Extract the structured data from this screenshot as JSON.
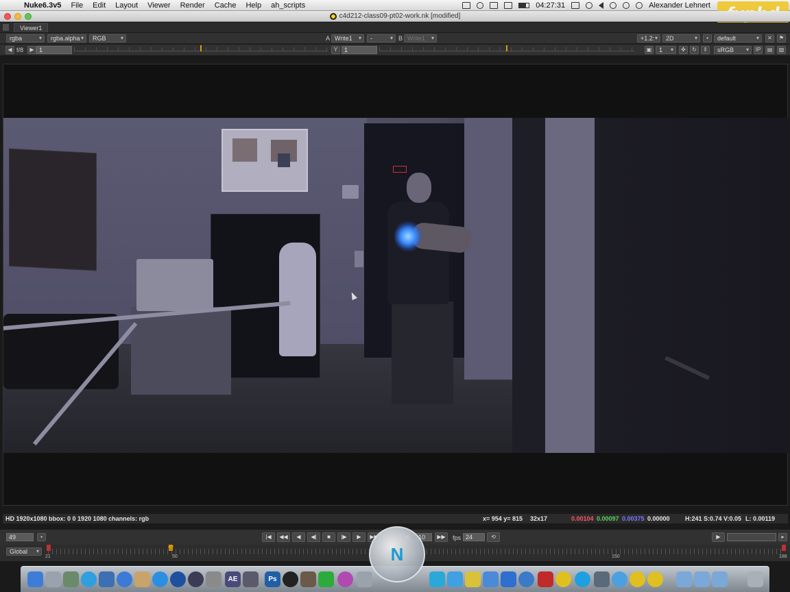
{
  "menubar": {
    "app_name": "Nuke6.3v5",
    "items": [
      "File",
      "Edit",
      "Layout",
      "Viewer",
      "Render",
      "Cache",
      "Help",
      "ah_scripts"
    ],
    "clock": "04:27:31",
    "user": "Alexander Lehnert"
  },
  "window": {
    "title": "c4d212-class09-pt02-work.nk [modified]"
  },
  "watermark": {
    "text": "fxphd"
  },
  "viewer_tab": {
    "label": "Viewer1"
  },
  "toolbar": {
    "channels": "rgba",
    "alpha_channel": "rgba.alpha",
    "display_channel": "RGB",
    "a_label": "A",
    "a_input": "Write1",
    "compare_mode": "-",
    "b_label": "B",
    "b_input": "Write1",
    "zoom": "+1.2:",
    "view_mode": "2D",
    "lut_default": "default",
    "proxy": "f/8",
    "gain_value": "1",
    "y_label": "Y",
    "gamma_value": "1",
    "downrez": "1",
    "viewer_lut": "sRGB",
    "ip_label": "IP"
  },
  "infobar": {
    "format": "HD 1920x1080 bbox: 0 0 1920 1080 channels: rgb",
    "coords": "x= 954 y= 815",
    "sample_size": "32x17",
    "r_value": "0.00104",
    "g_value": "0.00097",
    "b_value": "0.00375",
    "a_value": "0.00000",
    "hsv": "H:241 S:0.74 V:0.05",
    "luminance": "L: 0.00119"
  },
  "playback": {
    "current_frame": "49",
    "increment": "10",
    "fps_label": "fps",
    "fps_value": "24"
  },
  "timeline": {
    "range_mode": "Global",
    "start": "21",
    "tick_50": "50",
    "tick_150": "150",
    "end": "188",
    "marker_frame": "49"
  },
  "dock": {
    "icons": [
      "finder",
      "rocket",
      "preview",
      "app-store",
      "safari",
      "contacts",
      "itunes",
      "chrome",
      "cinema4d",
      "script-editor",
      "after-effects",
      "final-cut",
      "photoshop",
      "dvd",
      "iphoto",
      "green-app",
      "itunes-eq",
      "calendar",
      "nuke",
      "twitter",
      "cyberduck",
      "instruments",
      "quicktime",
      "acrobat",
      "radioactive",
      "skype",
      "video",
      "messages",
      "radioactive2",
      "radioactive3",
      "folder",
      "folder2",
      "folder3",
      "trash"
    ],
    "photoshop_label": "Ps",
    "ae_label": "AE",
    "nuke_badge": "N"
  }
}
